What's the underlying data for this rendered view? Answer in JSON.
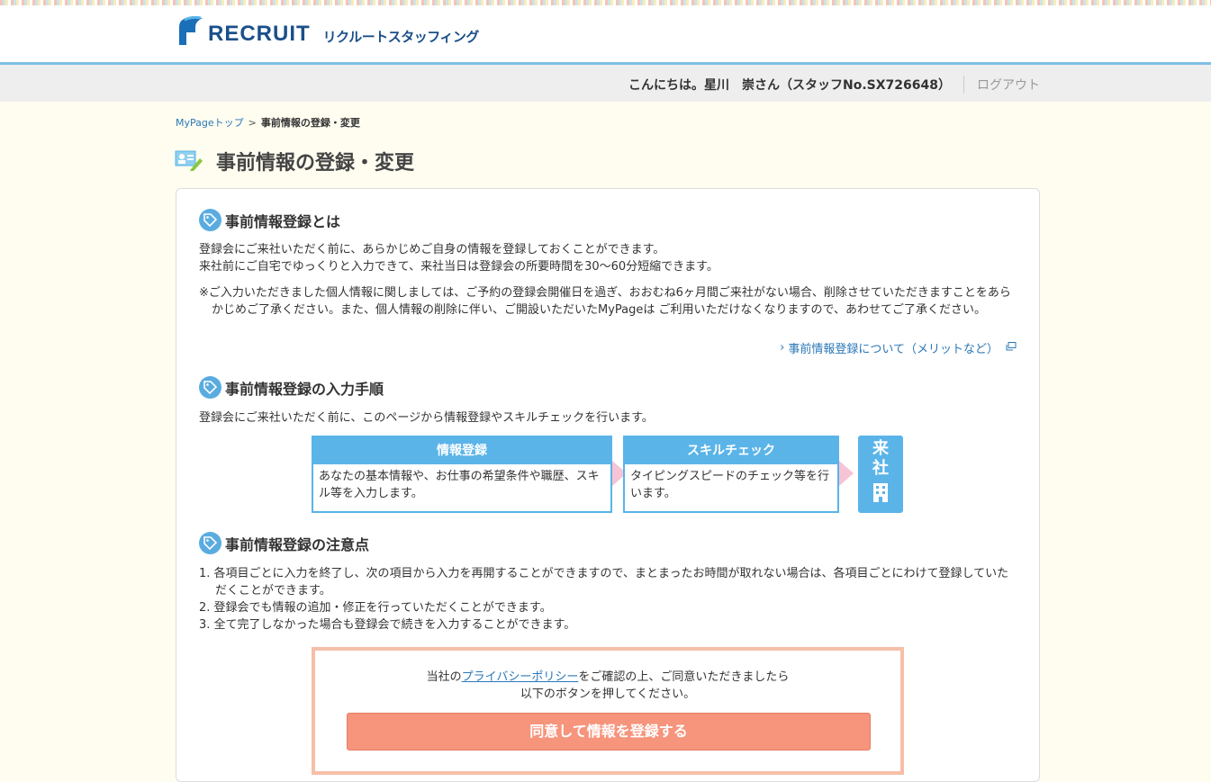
{
  "header": {
    "logo_text": "RECRUIT",
    "logo_sub": "リクルートスタッフィング"
  },
  "userbar": {
    "greeting": "こんにちは。星川　崇さん（スタッフNo.SX726648）",
    "logout": "ログアウト"
  },
  "breadcrumb": {
    "home": "MyPageトップ",
    "separator": ">",
    "current": "事前情報の登録・変更"
  },
  "page": {
    "title": "事前情報の登録・変更",
    "title_icon": "id-card-edit-icon"
  },
  "section1": {
    "heading": "事前情報登録とは",
    "line1": "登録会にご来社いただく前に、あらかじめご自身の情報を登録しておくことができます。",
    "line2": "来社前にご自宅でゆっくりと入力できて、来社当日は登録会の所要時間を30～60分短縮できます。",
    "note": "※ご入力いただきました個人情報に関しましては、ご予約の登録会開催日を過ぎ、おおむね6ヶ月間ご来社がない場合、削除させていただきますことをあらかじめご了承ください。また、個人情報の削除に伴い、ご開設いただいたMyPageは ご利用いただけなくなりますので、あわせてご了承ください。",
    "merit_link": "事前情報登録について（メリットなど）"
  },
  "section2": {
    "heading": "事前情報登録の入力手順",
    "intro": "登録会にご来社いただく前に、このページから情報登録やスキルチェックを行います。",
    "step1_title": "情報登録",
    "step1_body": "あなたの基本情報や、お仕事の希望条件や職歴、スキル等を入力します。",
    "step2_title": "スキルチェック",
    "step2_body": "タイピングスピードのチェック等を行います。",
    "visit_line1": "来",
    "visit_line2": "社"
  },
  "section3": {
    "heading": "事前情報登録の注意点",
    "items": [
      "1. 各項目ごとに入力を終了し、次の項目から入力を再開することができますので、まとまったお時間が取れない場合は、各項目ごとにわけて登録していただくことができます。",
      "2. 登録会でも情報の追加・修正を行っていただくことができます。",
      "3. 全て完了しなかった場合も登録会で続きを入力することができます。"
    ]
  },
  "consent": {
    "text_before": "当社の",
    "privacy_link": "プライバシーポリシー",
    "text_after": "をご確認の上、ご同意いただきましたら",
    "line2": "以下のボタンを押してください。",
    "button": "同意して情報を登録する"
  },
  "colors": {
    "accent_blue": "#5ab4e8",
    "button": "#f6947c",
    "link": "#2a78b8"
  }
}
